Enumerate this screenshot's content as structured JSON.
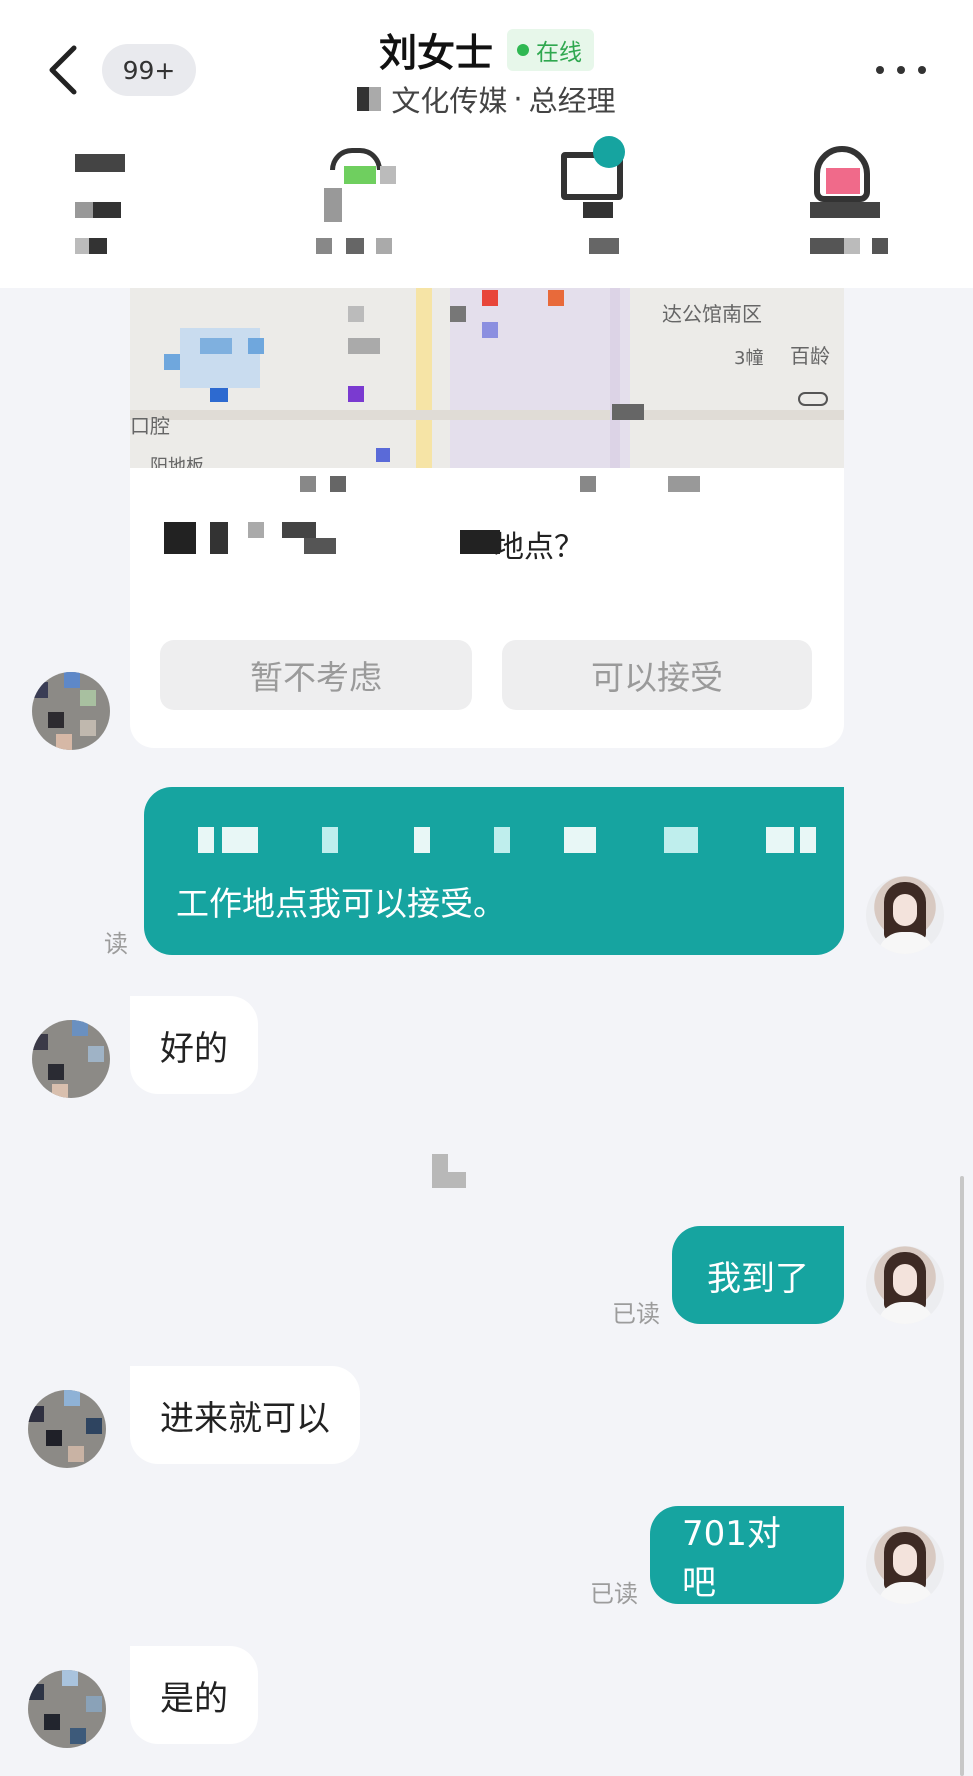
{
  "header": {
    "unread_count": "99+",
    "contact_name": "刘女士",
    "online_status": "在线",
    "company_suffix": "文化传媒",
    "separator": "·",
    "position": "总经理"
  },
  "card": {
    "map_labels": [
      "达公馆南区",
      "3幢",
      "百龄",
      "口腔",
      "阳地板"
    ],
    "question_end": "地点？",
    "decline_label": "暂不考虑",
    "accept_label": "可以接受"
  },
  "messages": [
    {
      "side": "right",
      "text": "工作地点我可以接受。",
      "read": "读"
    },
    {
      "side": "left",
      "text": "好的"
    },
    {
      "side": "right",
      "text": "我到了",
      "read": "已读"
    },
    {
      "side": "left",
      "text": "进来就可以"
    },
    {
      "side": "right",
      "text": "701对吧",
      "read": "已读"
    },
    {
      "side": "left",
      "text": "是的"
    }
  ],
  "colors": {
    "accent": "#16a4a0",
    "online": "#2fb852",
    "background": "#f3f4f8"
  }
}
